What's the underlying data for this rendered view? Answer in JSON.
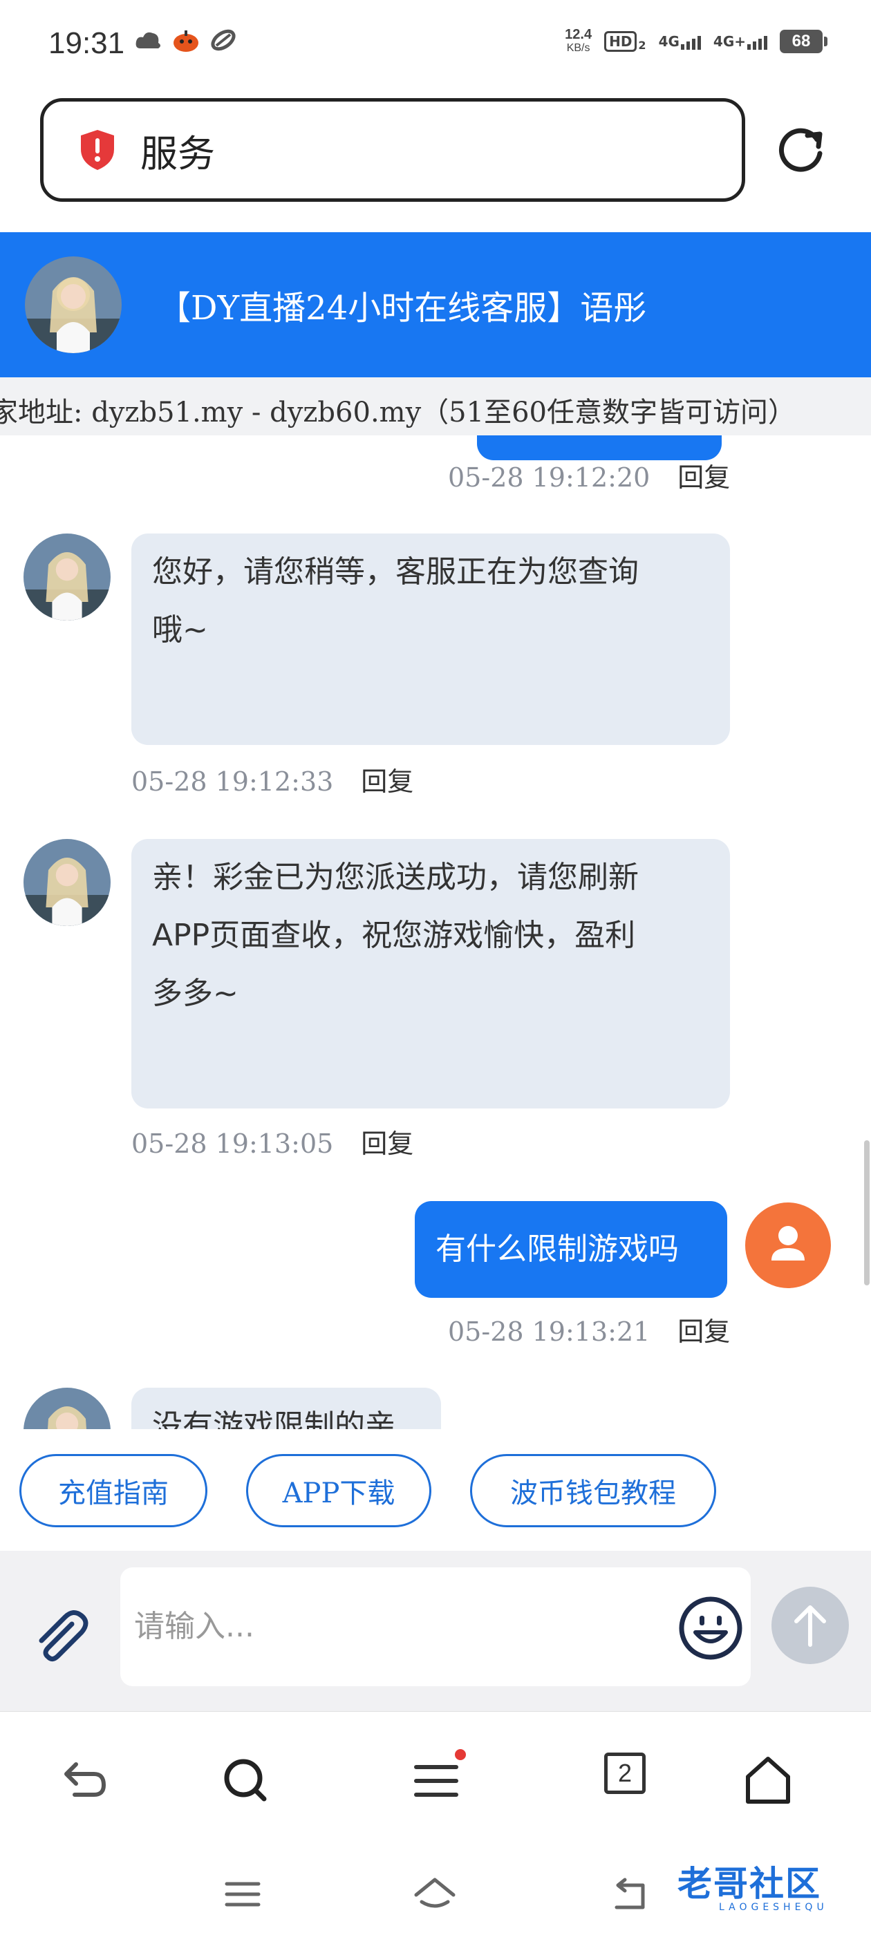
{
  "status_bar": {
    "time": "19:31",
    "speed_value": "12.4",
    "speed_unit": "KB/s",
    "hd_label": "HD",
    "hd_sub": "2",
    "net1": "4G",
    "net2": "4G+",
    "battery": "68"
  },
  "address_bar": {
    "text": "服务"
  },
  "header": {
    "title": "【DY直播24小时在线客服】语彤"
  },
  "marquee": {
    "text": "家地址: dyzb51.my - dyzb60.my（51至60任意数字皆可访问）"
  },
  "messages": [
    {
      "side": "out",
      "text": "",
      "time": "05-28 19:12:20",
      "reply": "回复"
    },
    {
      "side": "in",
      "lines": [
        "您好，请您稍等，客服正在为您查询",
        "哦~"
      ],
      "time": "05-28 19:12:33",
      "reply": "回复"
    },
    {
      "side": "in",
      "lines": [
        "亲！彩金已为您派送成功，请您刷新",
        "APP页面查收，祝您游戏愉快，盈利",
        "多多~"
      ],
      "time": "05-28 19:13:05",
      "reply": "回复"
    },
    {
      "side": "out",
      "text": "有什么限制游戏吗",
      "time": "05-28 19:13:21",
      "reply": "回复"
    },
    {
      "side": "in",
      "lines": [
        "没有游戏限制的亲"
      ]
    }
  ],
  "quick_links": [
    "充值指南",
    "APP下载",
    "波币钱包教程"
  ],
  "composer": {
    "placeholder": "请输入..."
  },
  "browser_nav": {
    "tab_count": "2"
  },
  "watermark": {
    "main": "老哥社区",
    "sub": "LAOGESHEQU"
  }
}
